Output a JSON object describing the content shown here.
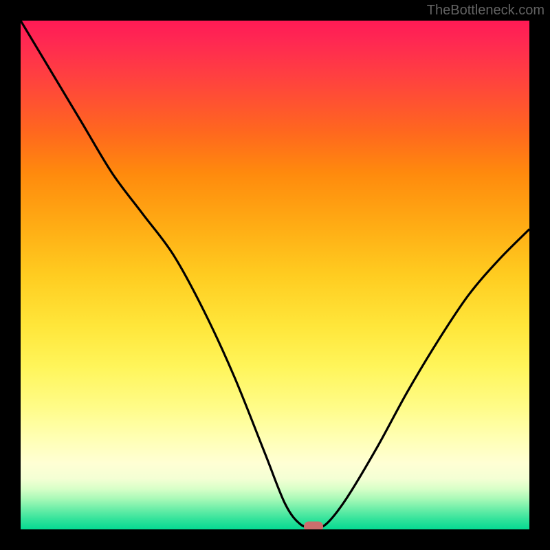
{
  "watermark": "TheBottleneck.com",
  "chart_data": {
    "type": "line",
    "title": "",
    "xlabel": "",
    "ylabel": "",
    "xlim": [
      0,
      100
    ],
    "ylim": [
      0,
      100
    ],
    "x": [
      0,
      6,
      12,
      18,
      24,
      30,
      36,
      42,
      48,
      52,
      55,
      57.5,
      60,
      64,
      70,
      76,
      82,
      88,
      94,
      100
    ],
    "y": [
      100,
      90,
      80,
      70,
      62,
      54,
      43,
      30,
      15,
      5,
      1,
      0.5,
      1,
      6,
      16,
      27,
      37,
      46,
      53,
      59
    ],
    "marker": {
      "x": 57.5,
      "y": 0.5
    },
    "colors": {
      "gradient_top": "#ff1a55",
      "gradient_mid": "#ffcc20",
      "gradient_bottom": "#05da92",
      "curve": "#000000",
      "marker": "#cb6e6d",
      "frame": "#000000"
    }
  }
}
